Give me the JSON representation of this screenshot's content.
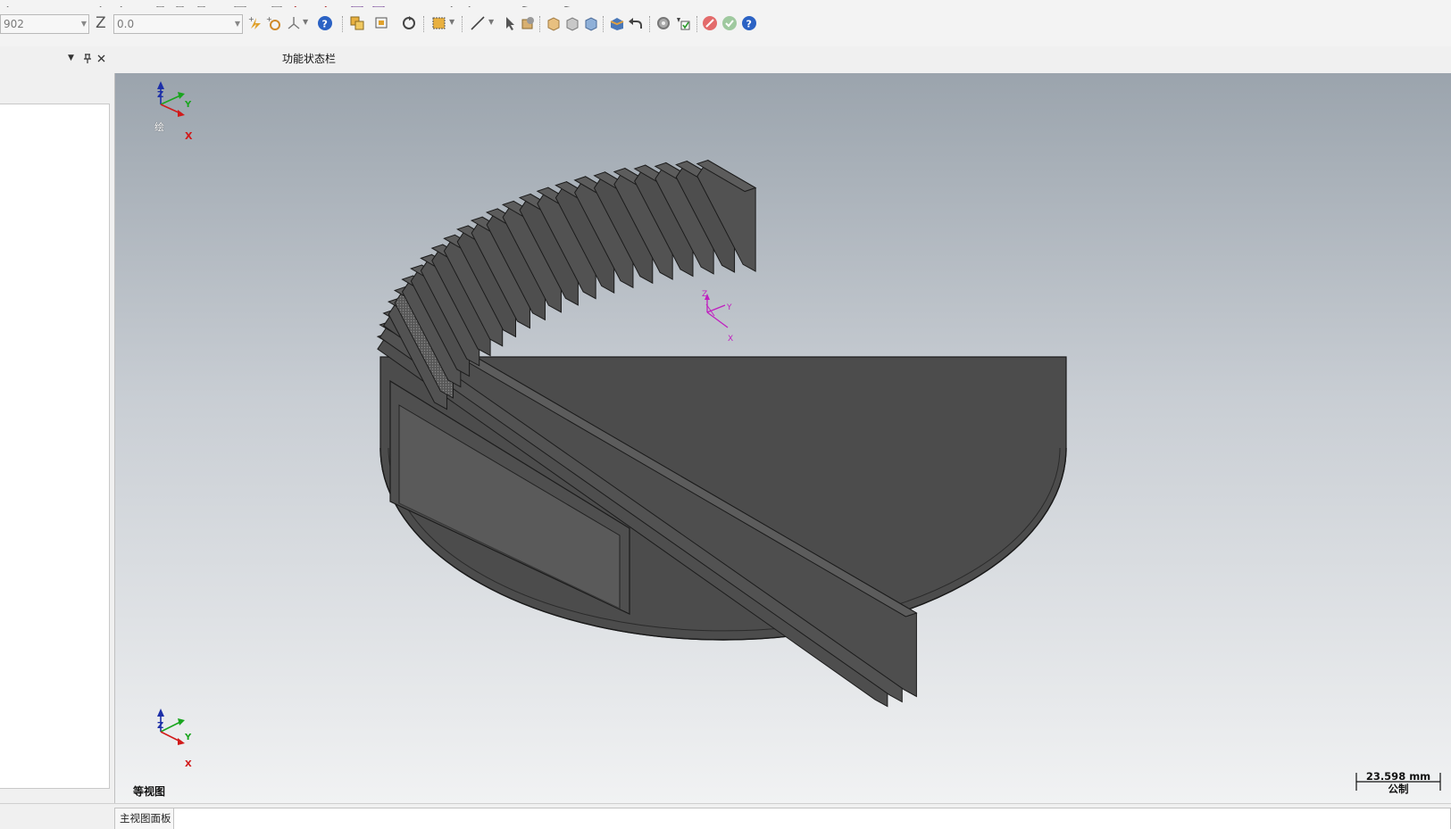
{
  "toolbar": {
    "y_value": "902",
    "z_label": "Z",
    "z_value": "0.0"
  },
  "panel": {
    "function_status_bar_title": "功能状态栏"
  },
  "viewport": {
    "triad_top_label": "绘",
    "view_name": "等视图",
    "scale_value": "23.598 mm",
    "scale_unit": "公制",
    "axis_z": "Z",
    "axis_y": "Y",
    "axis_x": "X"
  },
  "bottom_tabs": {
    "main_view_panel": "主视图面板"
  },
  "colors": {
    "axis_z": "#1d2fa8",
    "axis_y": "#19a51e",
    "axis_x": "#d11a1a",
    "model_fill": "#555555",
    "origin_marker": "#c01ec0"
  }
}
